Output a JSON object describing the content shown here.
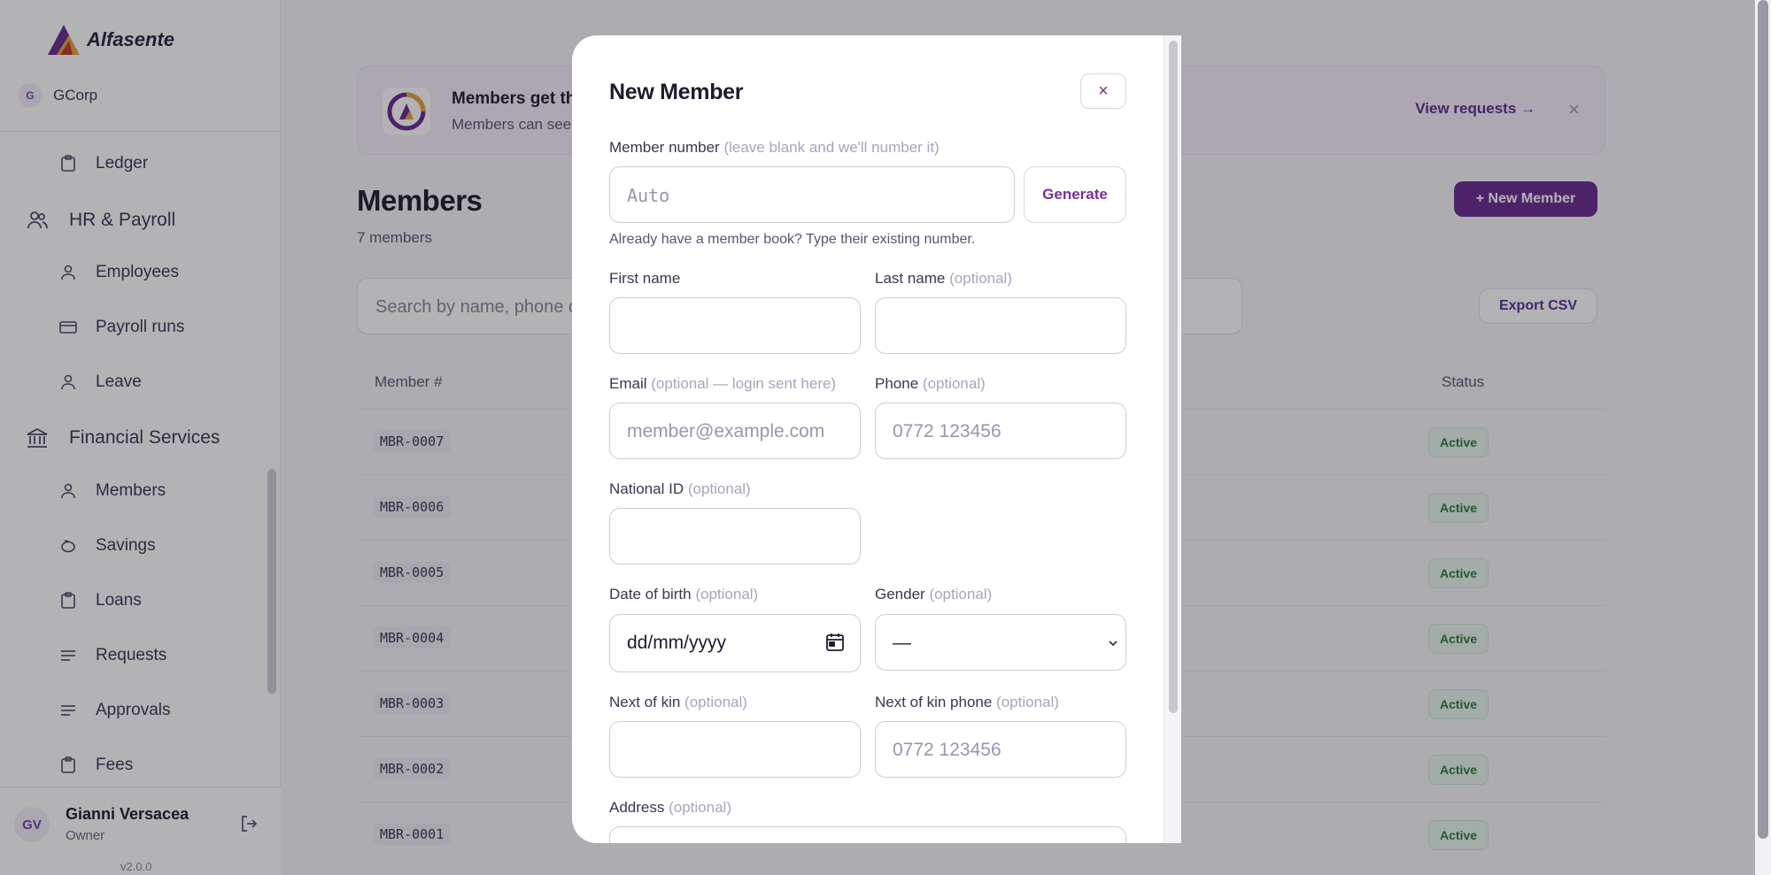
{
  "sidebar": {
    "brand": "Alfasente",
    "org_badge": "G",
    "org_name": "GCorp",
    "items": [
      {
        "label": "Ledger",
        "icon": "clipboard-icon"
      },
      {
        "label": "HR & Payroll",
        "icon": "people-icon"
      },
      {
        "label": "Employees",
        "icon": "person-icon"
      },
      {
        "label": "Payroll runs",
        "icon": "card-icon"
      },
      {
        "label": "Leave",
        "icon": "person-icon"
      },
      {
        "label": "Financial Services",
        "icon": "bank-icon"
      },
      {
        "label": "Members",
        "icon": "person-icon"
      },
      {
        "label": "Savings",
        "icon": "piggy-icon"
      },
      {
        "label": "Loans",
        "icon": "clipboard-icon"
      },
      {
        "label": "Requests",
        "icon": "list-icon"
      },
      {
        "label": "Approvals",
        "icon": "list-icon"
      },
      {
        "label": "Fees",
        "icon": "clipboard-icon"
      }
    ],
    "user": {
      "initials": "GV",
      "name": "Gianni Versacea",
      "role": "Owner"
    },
    "version": "v2.0.0"
  },
  "banner": {
    "title": "Members get th",
    "subtitle": "Members can see",
    "link": "View requests →",
    "close": "×"
  },
  "page": {
    "title": "Members",
    "count": "7 members",
    "new_member": "+ New Member",
    "search_placeholder": "Search by name, phone o",
    "export": "Export CSV"
  },
  "table": {
    "headers": {
      "member_no": "Member #",
      "status": "Status"
    },
    "rows": [
      {
        "member_no": "MBR-0007",
        "status": "Active"
      },
      {
        "member_no": "MBR-0006",
        "status": "Active"
      },
      {
        "member_no": "MBR-0005",
        "status": "Active"
      },
      {
        "member_no": "MBR-0004",
        "status": "Active"
      },
      {
        "member_no": "MBR-0003",
        "status": "Active"
      },
      {
        "member_no": "MBR-0002",
        "status": "Active"
      },
      {
        "member_no": "MBR-0001",
        "status": "Active"
      }
    ]
  },
  "modal": {
    "title": "New Member",
    "close": "×",
    "member_number": {
      "label": "Member number",
      "optional": "(leave blank and we'll number it)",
      "placeholder": "Auto",
      "generate": "Generate",
      "hint": "Already have a member book? Type their existing number."
    },
    "first_name": {
      "label": "First name"
    },
    "last_name": {
      "label": "Last name",
      "optional": "(optional)"
    },
    "email": {
      "label": "Email",
      "optional": "(optional — login sent here)",
      "placeholder": "member@example.com"
    },
    "phone": {
      "label": "Phone",
      "optional": "(optional)",
      "placeholder": "0772 123456"
    },
    "national_id": {
      "label": "National ID",
      "optional": "(optional)"
    },
    "dob": {
      "label": "Date of birth",
      "optional": "(optional)",
      "value": "dd/mm/yyyy"
    },
    "gender": {
      "label": "Gender",
      "optional": "(optional)",
      "value": "—"
    },
    "next_of_kin": {
      "label": "Next of kin",
      "optional": "(optional)"
    },
    "next_of_kin_phone": {
      "label": "Next of kin phone",
      "optional": "(optional)",
      "placeholder": "0772 123456"
    },
    "address": {
      "label": "Address",
      "optional": "(optional)"
    }
  },
  "colors": {
    "accent": "#6a2a8c",
    "active_green": "#2f7a3a"
  }
}
